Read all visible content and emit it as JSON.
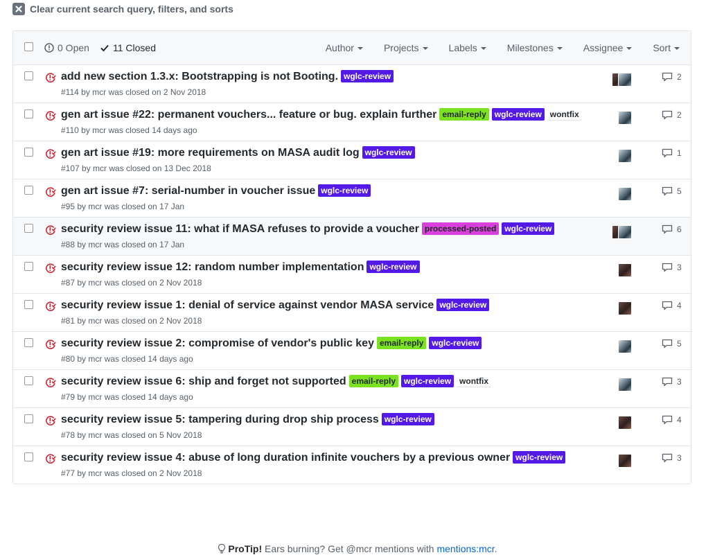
{
  "clear": {
    "label": "Clear current search query, filters, and sorts"
  },
  "header": {
    "open_label": "0 Open",
    "closed_label": "11 Closed",
    "filters": [
      "Author",
      "Projects",
      "Labels",
      "Milestones",
      "Assignee",
      "Sort"
    ]
  },
  "colors": {
    "closed_icon": "#cb2431",
    "wglc-review": "#5319e7",
    "email-reply": "#7be221",
    "processed-posted": "#d93fdb",
    "wontfix": "#ffffff"
  },
  "issues": [
    {
      "title": "add new section 1.3.x: Bootstrapping is not Booting.",
      "labels": [
        "wglc-review"
      ],
      "meta": "#114 by mcr was closed on 2 Nov 2018",
      "comments": "2",
      "assignees": [
        "mcr",
        "other"
      ]
    },
    {
      "title": "gen art issue #22: permanent vouchers... feature or bug. explain further",
      "labels": [
        "email-reply",
        "wglc-review",
        "wontfix"
      ],
      "meta": "#110 by mcr was closed 14 days ago",
      "comments": "2",
      "assignees": [
        "other"
      ]
    },
    {
      "title": "gen art issue #19: more requirements on MASA audit log",
      "labels": [
        "wglc-review"
      ],
      "meta": "#107 by mcr was closed on 13 Dec 2018",
      "comments": "1",
      "assignees": [
        "other"
      ]
    },
    {
      "title": "gen art issue #7: serial-number in voucher issue",
      "labels": [
        "wglc-review"
      ],
      "meta": "#95 by mcr was closed on 17 Jan",
      "comments": "5",
      "assignees": [
        "other"
      ]
    },
    {
      "title": "security review issue 11: what if MASA refuses to provide a voucher",
      "labels": [
        "processed-posted",
        "wglc-review"
      ],
      "meta": "#88 by mcr was closed on 17 Jan",
      "comments": "6",
      "assignees": [
        "mcr",
        "other"
      ],
      "highlight": true
    },
    {
      "title": "security review issue 12: random number implementation",
      "labels": [
        "wglc-review"
      ],
      "meta": "#87 by mcr was closed on 2 Nov 2018",
      "comments": "3",
      "assignees": [
        "mcr"
      ]
    },
    {
      "title": "security review issue 1: denial of service against vendor MASA service",
      "labels": [
        "wglc-review"
      ],
      "meta": "#81 by mcr was closed on 2 Nov 2018",
      "comments": "4",
      "assignees": [
        "mcr"
      ]
    },
    {
      "title": "security review issue 2: compromise of vendor's public key",
      "labels": [
        "email-reply",
        "wglc-review"
      ],
      "meta": "#80 by mcr was closed 14 days ago",
      "comments": "5",
      "assignees": [
        "other"
      ]
    },
    {
      "title": "security review issue 6: ship and forget not supported",
      "labels": [
        "email-reply",
        "wglc-review",
        "wontfix"
      ],
      "meta": "#79 by mcr was closed 14 days ago",
      "comments": "3",
      "assignees": [
        "other"
      ]
    },
    {
      "title": "security review issue 5: tampering during drop ship process",
      "labels": [
        "wglc-review"
      ],
      "meta": "#78 by mcr was closed on 5 Nov 2018",
      "comments": "4",
      "assignees": [
        "mcr"
      ]
    },
    {
      "title": "security review issue 4: abuse of long duration infinite vouchers by a previous owner",
      "labels": [
        "wglc-review"
      ],
      "meta": "#77 by mcr was closed on 2 Nov 2018",
      "comments": "3",
      "assignees": [
        "mcr"
      ]
    }
  ],
  "protip": {
    "strong": "ProTip!",
    "text": " Ears burning? Get @mcr mentions with ",
    "link": "mentions:mcr",
    "end": "."
  }
}
